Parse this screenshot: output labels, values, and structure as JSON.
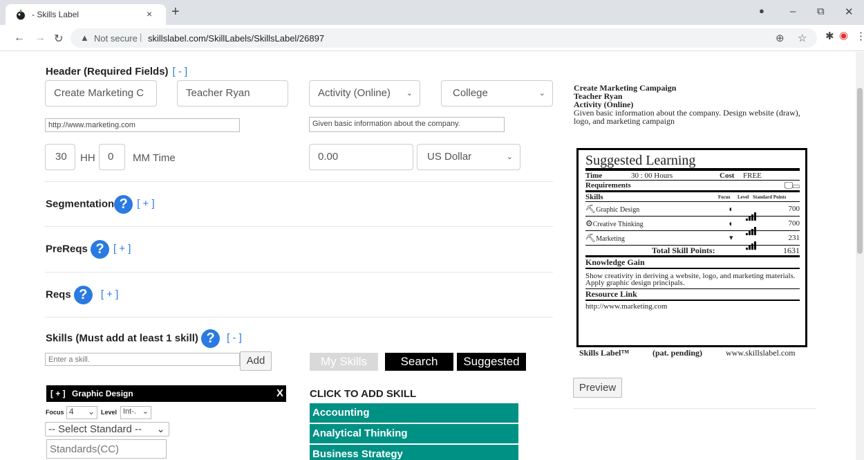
{
  "browser": {
    "tab_title": "- Skills Label",
    "tab_close": "×",
    "new_tab": "+",
    "not_secure": "Not secure",
    "url": "skillslabel.com/SkillLabels/SkillsLabel/26897"
  },
  "header_section": {
    "title": "Header (Required Fields)",
    "toggle": "[ - ]",
    "activity_name": "Create Marketing C",
    "teacher": "Teacher Ryan",
    "activity_type": "Activity (Online)",
    "level": "College",
    "url_value": "http://www.marketing.com",
    "description_value": "Given basic information about the company.",
    "hours_value": "30",
    "hours_label": "HH",
    "minutes_value": "0",
    "time_label": "MM Time",
    "cost_value": "0.00",
    "currency": "US Dollar"
  },
  "segmentation": {
    "title": "Segmentation",
    "toggle": "[ + ]"
  },
  "prereqs": {
    "title": "PreReqs",
    "toggle": "[ + ]"
  },
  "reqs": {
    "title": "Reqs",
    "toggle": "[ + ]"
  },
  "skills_section": {
    "title": "Skills (Must add at least 1 skill)",
    "toggle": "[ - ]",
    "input_placeholder": "Enter a skill.",
    "add_label": "Add",
    "tabs": [
      "My Skills",
      "Search",
      "Suggested"
    ],
    "click_to_add": "CLICK TO ADD SKILL",
    "categories": [
      "Accounting",
      "Analytical Thinking",
      "Business Strategy"
    ],
    "added_skill": {
      "toggle": "[ + ]",
      "name": "Graphic Design",
      "remove": "X",
      "focus_label": "Focus",
      "focus_value": "4",
      "level_label": "Level",
      "level_value": "Int-.",
      "standard_select": "-- Select Standard --",
      "standards_placeholder": "Standards(CC)"
    }
  },
  "preview": {
    "name": "Create Marketing Campaign",
    "teacher": "Teacher Ryan",
    "type": "Activity (Online)",
    "description": "Given basic information about the company. Design website (draw), logo, and marketing campaign",
    "preview_button": "Preview"
  },
  "skills_label": {
    "title": "Suggested Learning",
    "time_label": "Time",
    "time_value": "30 : 00 Hours",
    "cost_label": "Cost",
    "cost_value": "FREE",
    "requirements_label": "Requirements",
    "skills_label": "Skills",
    "col_focus": "Focus",
    "col_level": "Level",
    "col_points": "Standard Points",
    "skills": [
      {
        "name": "Graphic Design",
        "points": "700",
        "level": 4
      },
      {
        "name": "Creative Thinking",
        "points": "700",
        "level": 4
      },
      {
        "name": "Marketing",
        "points": "231",
        "level": 4
      }
    ],
    "total_label": "Total Skill Points:",
    "total_value": "1631",
    "knowledge_label": "Knowledge Gain",
    "knowledge_text": "Show creativity in deriving a website, logo, and marketing materials. Apply graphic design principals.",
    "resource_label": "Resource Link",
    "resource_value": "http://www.marketing.com",
    "footer_brand": "Skills Label™",
    "footer_pending": "(pat. pending)",
    "footer_site": "www.skillslabel.com"
  }
}
